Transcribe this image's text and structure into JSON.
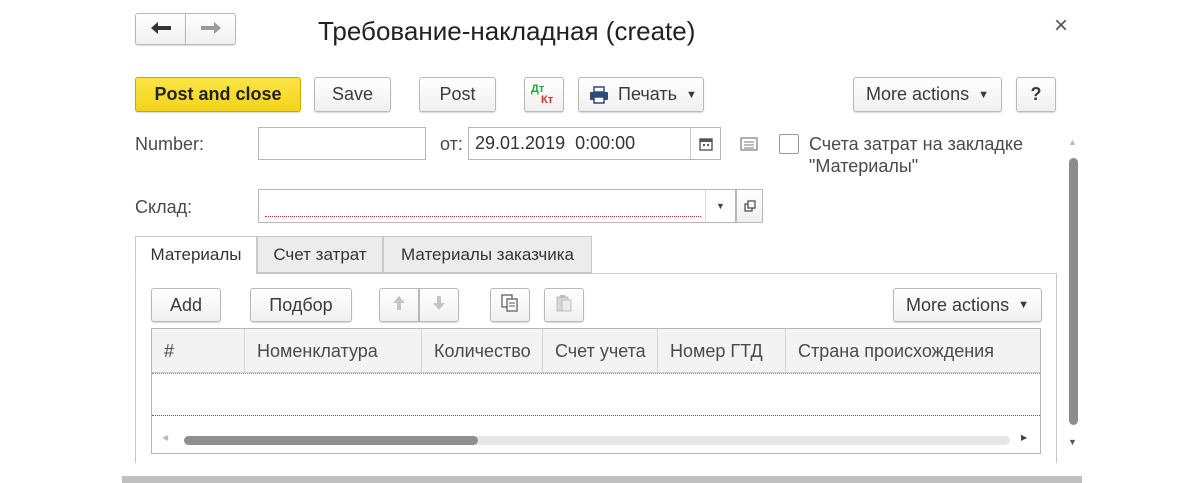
{
  "window": {
    "title": "Требование-накладная (create)",
    "close_glyph": "×"
  },
  "nav": {
    "back_glyph": "🡐",
    "forward_glyph": "🡒"
  },
  "toolbar": {
    "post_close_label": "Post and close",
    "save_label": "Save",
    "post_label": "Post",
    "dtkt_dt": "Дт",
    "dtkt_kt": "Кт",
    "print_label": "Печать",
    "more_actions_label": "More actions",
    "help_label": "?"
  },
  "form": {
    "number_label": "Number:",
    "number_value": "",
    "from_label": "от:",
    "date_value": "29.01.2019  0:00:00",
    "checkbox_label_line1": "Счета затрат на закладке",
    "checkbox_label_line2": "\"Материалы\"",
    "warehouse_label": "Склад:",
    "warehouse_value": ""
  },
  "tabs": [
    {
      "label": "Материалы",
      "active": true
    },
    {
      "label": "Счет затрат",
      "active": false
    },
    {
      "label": "Материалы заказчика",
      "active": false
    }
  ],
  "table_toolbar": {
    "add_label": "Add",
    "selection_label": "Подбор",
    "more_actions_label": "More actions"
  },
  "table": {
    "columns": [
      "#",
      "Номенклатура",
      "Количество",
      "Счет учета",
      "Номер ГТД",
      "Страна происхождения"
    ],
    "rows": []
  },
  "colors": {
    "primary_button": "#f5d92a",
    "required_underline": "#c0392b",
    "accent_dtkt_green": "#2e9e44",
    "accent_dtkt_red": "#d0332b"
  }
}
